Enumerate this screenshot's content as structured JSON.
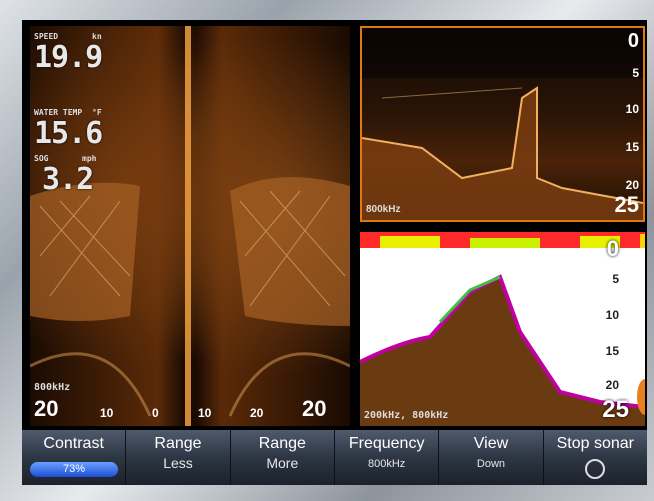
{
  "side_view": {
    "speed_label": "SPEED",
    "speed_unit": "kn",
    "speed_value": "19.9",
    "temp_label": "WATER TEMP",
    "temp_unit": "°F",
    "temp_value": "15.6",
    "sog_label": "SOG",
    "sog_unit": "mph",
    "sog_value": "3.2",
    "frequency": "800kHz",
    "range_left": "20",
    "range_right": "20",
    "scale": [
      "10",
      "0",
      "10",
      "20"
    ]
  },
  "down_view": {
    "frequency": "800kHz",
    "depth_top": "0",
    "depth_bottom": "25",
    "ticks": [
      "5",
      "10",
      "15",
      "20"
    ]
  },
  "sonar_view": {
    "frequency": "200kHz, 800kHz",
    "depth_top": "0",
    "depth_bottom": "25",
    "ticks": [
      "5",
      "10",
      "15",
      "20"
    ]
  },
  "menu": {
    "contrast": {
      "label": "Contrast",
      "value": "73%",
      "fraction": 0.73
    },
    "range_less": {
      "label": "Range",
      "sub": "Less"
    },
    "range_more": {
      "label": "Range",
      "sub": "More"
    },
    "frequency": {
      "label": "Frequency",
      "sub": "800kHz"
    },
    "view": {
      "label": "View",
      "sub": "Down"
    },
    "stop": {
      "label": "Stop sonar"
    }
  },
  "colors": {
    "accent": "#e07a10",
    "contrast_bar": "#1c4fd4"
  }
}
